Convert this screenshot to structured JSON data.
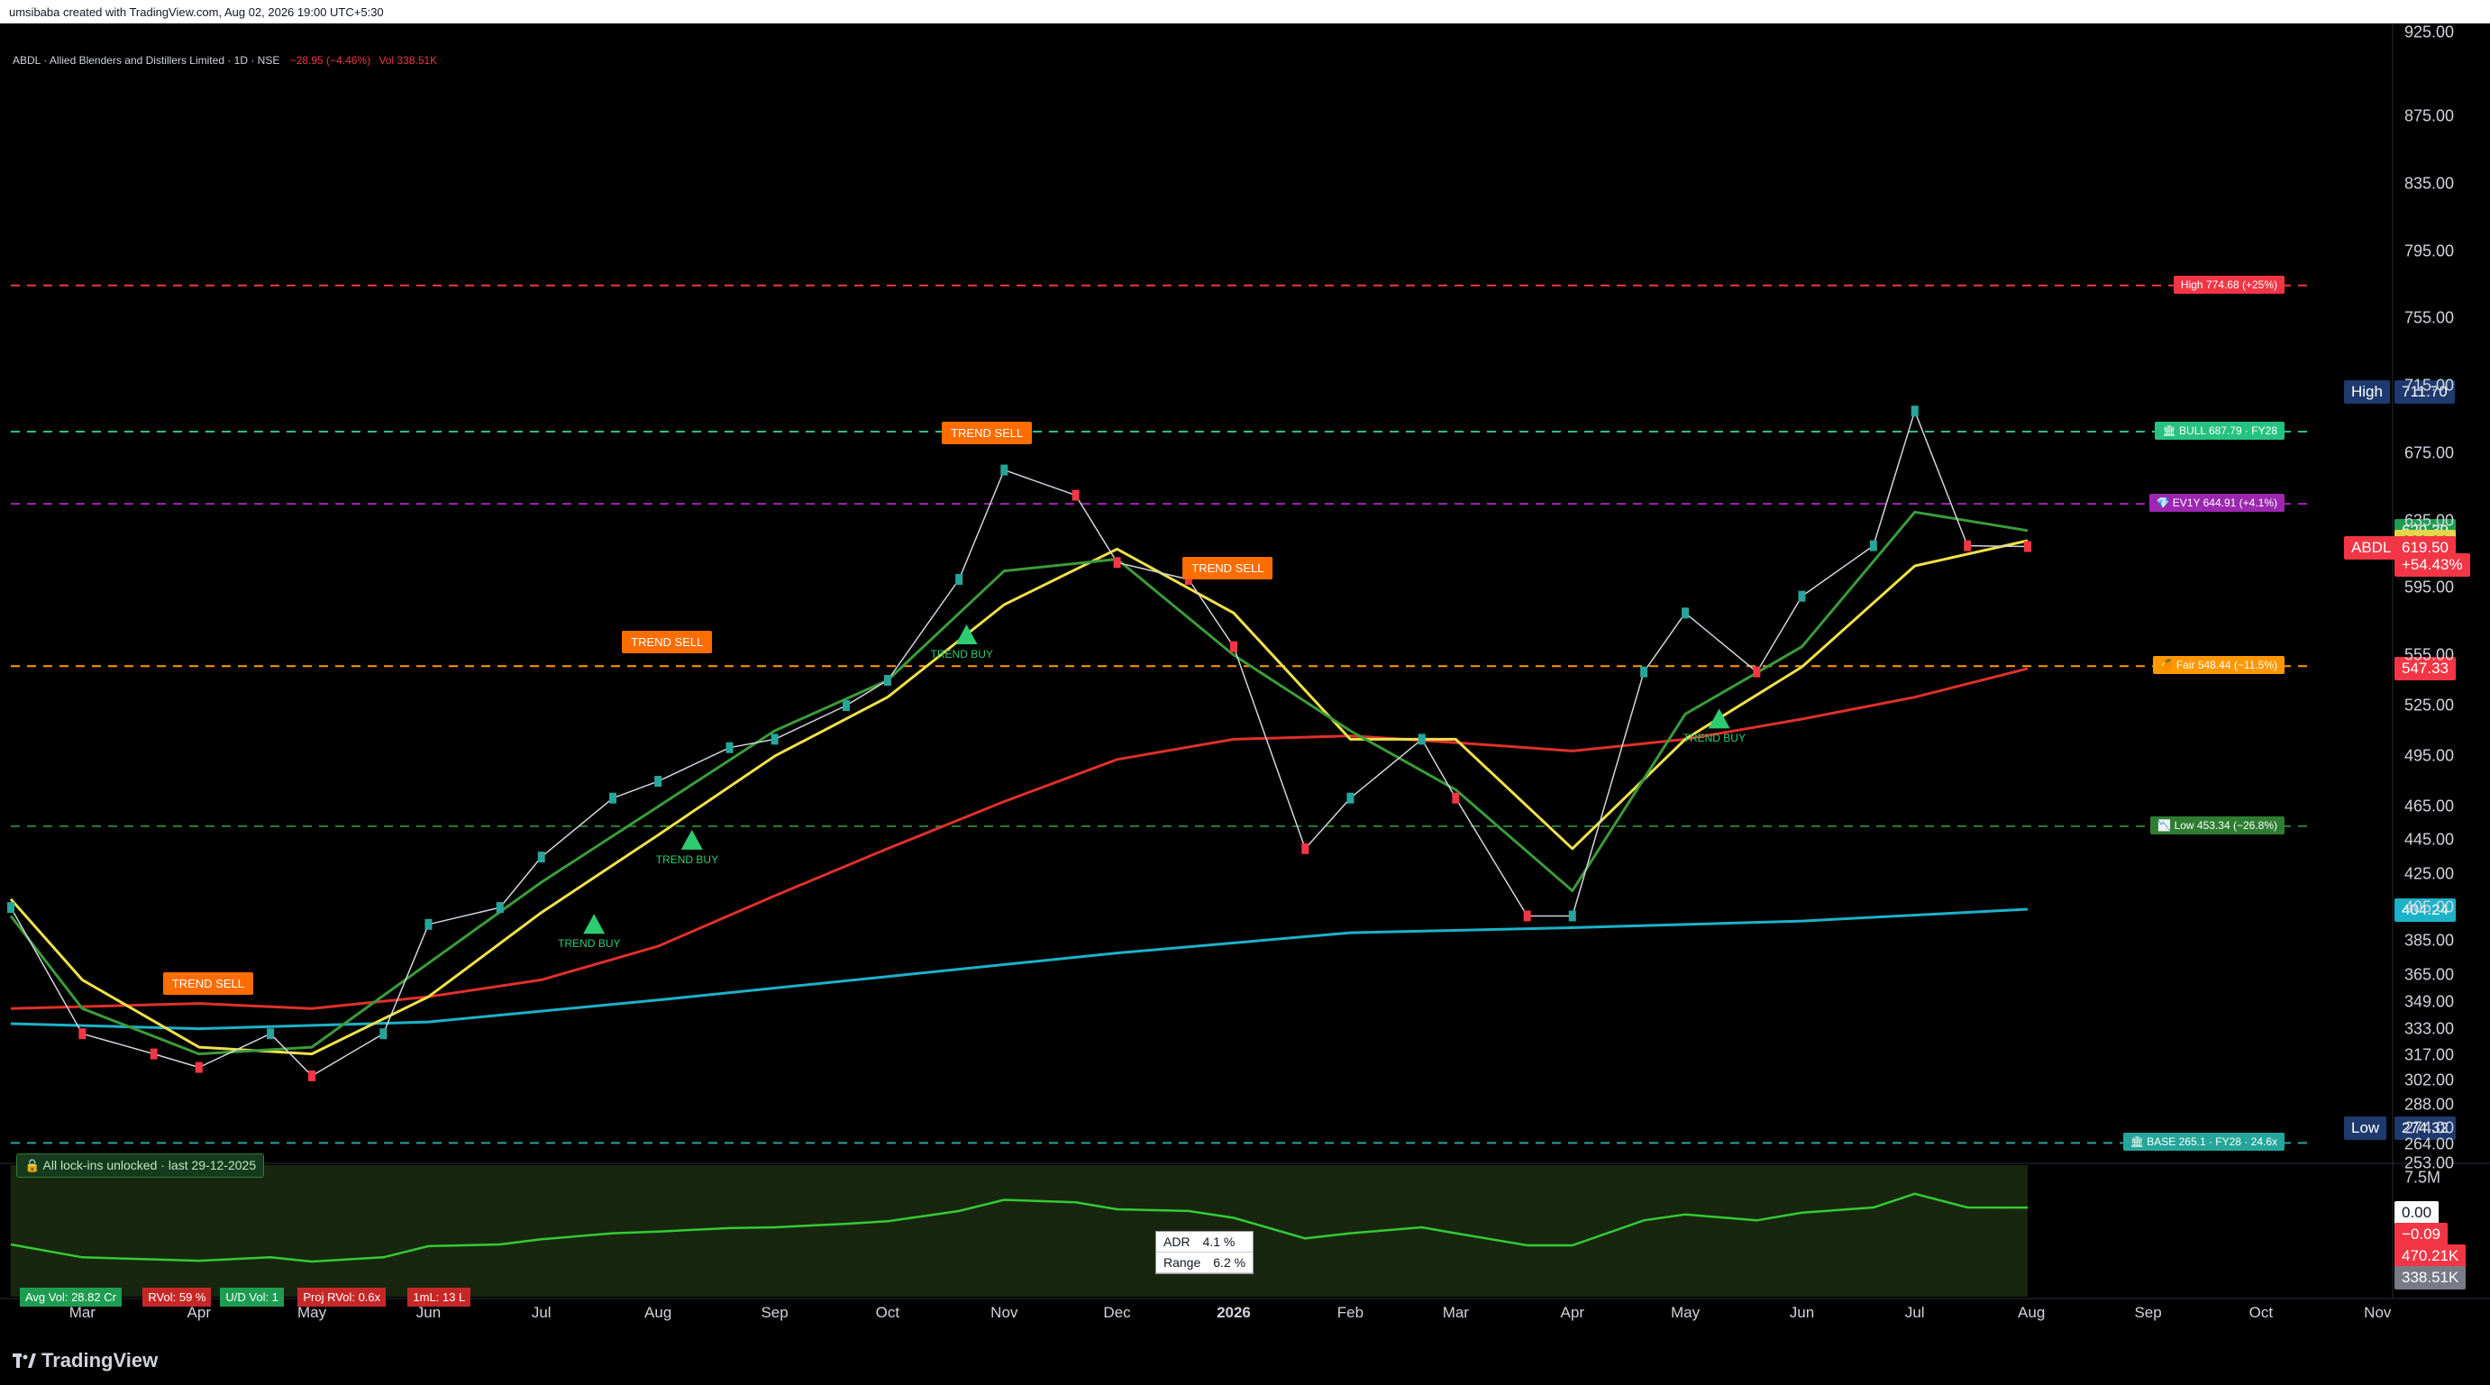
{
  "header": {
    "credit": "umsibaba created with TradingView.com, Aug 02, 2026 19:00 UTC+5:30"
  },
  "legend": {
    "symbol": "ABDL · Allied Blenders and Distillers Limited · 1D · NSE",
    "change": "−28.95 (−4.46%)",
    "vol_label": "Vol",
    "vol_value": "338.51K"
  },
  "lockin": "🔒 All lock-ins unlocked · last 29-12-2025",
  "footer": {
    "brand": "TradingView"
  },
  "colors": {
    "up": "#26a69a",
    "down": "#f23645",
    "ema_fast": "#3a9c3a",
    "ema_mid": "#f0e04a",
    "ema_slow": "#e0302a",
    "ema_long": "#1cb2c8",
    "bg": "#000000"
  },
  "chart_data": {
    "type": "line",
    "price_levels": {
      "high_target": {
        "label": "High 774.68 (+25%)",
        "value": 774.68,
        "color": "#f23645"
      },
      "bull": {
        "label": "🏛 BULL 687.79 · FY28",
        "value": 687.79,
        "color": "#26c281"
      },
      "ev1y": {
        "label": "💎 EV1Y 644.91 (+4.1%)",
        "value": 644.91,
        "color": "#9c27b0"
      },
      "fair": {
        "label": "🍊 Fair 548.44 (−11.5%)",
        "value": 548.44,
        "color": "#ff9800"
      },
      "low_target": {
        "label": "📉 Low 453.34 (−26.8%)",
        "value": 453.34,
        "color": "#2e7d32"
      },
      "base": {
        "label": "🏛 BASE 265.1 · FY28 · 24.6x",
        "value": 265.1,
        "color": "#26a69a"
      }
    },
    "right_tags": [
      {
        "label": "High",
        "value": "711.70",
        "color": "#1e3a6e",
        "y": 711.7
      },
      {
        "label": "",
        "value": "629.39",
        "color": "#1e9d52",
        "y": 629.39
      },
      {
        "label": "",
        "value": "622.98",
        "color": "#e6d44a",
        "y": 622.98
      },
      {
        "label": "ABDL",
        "value": "619.50",
        "color": "#f23645",
        "y": 619.5
      },
      {
        "label": "",
        "value": "+54.43%",
        "color": "#f23645",
        "y": 609.0
      },
      {
        "label": "",
        "value": "547.33",
        "color": "#f23645",
        "y": 547.33
      },
      {
        "label": "",
        "value": "404.24",
        "color": "#1cb2c8",
        "y": 404.24
      },
      {
        "label": "Low",
        "value": "274.32",
        "color": "#1e3a6e",
        "y": 274.32
      }
    ],
    "y_ticks": [
      "925.00",
      "875.00",
      "835.00",
      "795.00",
      "755.00",
      "715.00",
      "675.00",
      "635.00",
      "595.00",
      "555.00",
      "525.00",
      "495.00",
      "465.00",
      "445.00",
      "425.00",
      "405.00",
      "385.00",
      "365.00",
      "349.00",
      "333.00",
      "317.00",
      "302.00",
      "288.00",
      "274.00",
      "264.00",
      "253.00"
    ],
    "x_ticks": [
      {
        "label": "Mar",
        "date": "2025-03-01"
      },
      {
        "label": "Apr",
        "date": "2025-04-01"
      },
      {
        "label": "May",
        "date": "2025-05-01"
      },
      {
        "label": "Jun",
        "date": "2025-06-01"
      },
      {
        "label": "Jul",
        "date": "2025-07-01"
      },
      {
        "label": "Aug",
        "date": "2025-08-01"
      },
      {
        "label": "Sep",
        "date": "2025-09-01"
      },
      {
        "label": "Oct",
        "date": "2025-10-01"
      },
      {
        "label": "Nov",
        "date": "2025-11-01"
      },
      {
        "label": "Dec",
        "date": "2025-12-01"
      },
      {
        "label": "2026",
        "date": "2026-01-01"
      },
      {
        "label": "Feb",
        "date": "2026-02-01"
      },
      {
        "label": "Mar",
        "date": "2026-03-01"
      },
      {
        "label": "Apr",
        "date": "2026-04-01"
      },
      {
        "label": "May",
        "date": "2026-05-01"
      },
      {
        "label": "Jun",
        "date": "2026-06-01"
      },
      {
        "label": "Jul",
        "date": "2026-07-01"
      },
      {
        "label": "Aug",
        "date": "2026-08-01"
      },
      {
        "label": "Sep",
        "date": "2026-09-01"
      },
      {
        "label": "Oct",
        "date": "2026-10-01"
      },
      {
        "label": "Nov",
        "date": "2026-11-01"
      }
    ],
    "series": [
      {
        "name": "",
        "color": "#1cb2c8",
        "x": [
          "2025-02-10",
          "2025-04-01",
          "2025-06-01",
          "2025-08-01",
          "2025-10-01",
          "2025-12-01",
          "2026-02-01",
          "2026-04-01",
          "2026-06-01",
          "2026-07-31"
        ],
        "y": [
          336,
          333,
          337,
          350,
          364,
          378,
          390,
          393,
          397,
          404
        ]
      },
      {
        "name": "",
        "color": "#e0302a",
        "x": [
          "2025-02-10",
          "2025-04-01",
          "2025-05-01",
          "2025-06-01",
          "2025-07-01",
          "2025-08-01",
          "2025-09-01",
          "2025-10-01",
          "2025-11-01",
          "2025-12-01",
          "2026-01-01",
          "2026-02-01",
          "2026-03-01",
          "2026-04-01",
          "2026-05-01",
          "2026-06-01",
          "2026-07-01",
          "2026-07-31"
        ],
        "y": [
          345,
          348,
          345,
          352,
          362,
          382,
          412,
          440,
          468,
          493,
          505,
          507,
          503,
          498,
          505,
          517,
          530,
          547
        ]
      },
      {
        "name": "",
        "color": "#f0e04a",
        "x": [
          "2025-02-10",
          "2025-03-01",
          "2025-04-01",
          "2025-05-01",
          "2025-06-01",
          "2025-07-01",
          "2025-08-01",
          "2025-09-01",
          "2025-10-01",
          "2025-11-01",
          "2025-12-01",
          "2026-01-01",
          "2026-02-01",
          "2026-03-01",
          "2026-04-01",
          "2026-05-01",
          "2026-06-01",
          "2026-07-01",
          "2026-07-31"
        ],
        "y": [
          410,
          362,
          322,
          318,
          352,
          402,
          448,
          495,
          530,
          585,
          618,
          580,
          505,
          505,
          440,
          505,
          548,
          608,
          623
        ]
      },
      {
        "name": "",
        "color": "#3a9c3a",
        "x": [
          "2025-02-10",
          "2025-03-01",
          "2025-04-01",
          "2025-05-01",
          "2025-06-01",
          "2025-07-01",
          "2025-08-01",
          "2025-09-01",
          "2025-10-01",
          "2025-11-01",
          "2025-12-01",
          "2026-01-01",
          "2026-02-01",
          "2026-03-01",
          "2026-04-01",
          "2026-05-01",
          "2026-06-01",
          "2026-07-01",
          "2026-07-31"
        ],
        "y": [
          400,
          345,
          318,
          322,
          372,
          420,
          465,
          510,
          540,
          605,
          612,
          555,
          510,
          475,
          415,
          520,
          560,
          640,
          629
        ]
      },
      {
        "name": "",
        "color": "#d1d4dc",
        "x": [
          "2025-02-10",
          "2025-03-01",
          "2025-03-20",
          "2025-04-01",
          "2025-04-20",
          "2025-05-01",
          "2025-05-20",
          "2025-06-01",
          "2025-06-20",
          "2025-07-01",
          "2025-07-20",
          "2025-08-01",
          "2025-08-20",
          "2025-09-01",
          "2025-09-20",
          "2025-10-01",
          "2025-10-20",
          "2025-11-01",
          "2025-11-20",
          "2025-12-01",
          "2025-12-20",
          "2026-01-01",
          "2026-01-20",
          "2026-02-01",
          "2026-02-20",
          "2026-03-01",
          "2026-03-20",
          "2026-04-01",
          "2026-04-20",
          "2026-05-01",
          "2026-05-20",
          "2026-06-01",
          "2026-06-20",
          "2026-07-01",
          "2026-07-15",
          "2026-07-31"
        ],
        "y": [
          405,
          330,
          318,
          310,
          330,
          305,
          330,
          395,
          405,
          435,
          470,
          480,
          500,
          505,
          525,
          540,
          600,
          665,
          650,
          610,
          600,
          560,
          440,
          470,
          505,
          470,
          400,
          400,
          545,
          580,
          545,
          590,
          620,
          700,
          620,
          619.5
        ]
      }
    ],
    "signals": [
      {
        "text": "TREND SELL",
        "date": "2025-04-01",
        "price": 345
      },
      {
        "text": "TREND SELL",
        "date": "2025-08-01",
        "price": 548
      },
      {
        "text": "TREND SELL",
        "date": "2025-10-25",
        "price": 672
      },
      {
        "text": "TREND SELL",
        "date": "2025-12-28",
        "price": 592
      },
      {
        "text": "TREND BUY",
        "date": "2025-07-15",
        "price": 398
      },
      {
        "text": "TREND BUY",
        "date": "2025-08-10",
        "price": 448
      },
      {
        "text": "TREND BUY",
        "date": "2025-10-22",
        "price": 570
      },
      {
        "text": "TREND BUY",
        "date": "2026-05-10",
        "price": 520
      }
    ],
    "ylim": [
      253,
      925
    ],
    "xlim": [
      "2025-02-10",
      "2026-11-05"
    ],
    "grid": false,
    "sub_panel": {
      "y_ticks": [
        "7.5M"
      ],
      "tags": [
        {
          "value": "0.00",
          "color": "#ffffff",
          "text_color": "#131722"
        },
        {
          "value": "−0.09",
          "color": "#f23645",
          "text_color": "#ffffff"
        },
        {
          "value": "470.21K",
          "color": "#f23645",
          "text_color": "#ffffff"
        },
        {
          "value": "338.51K",
          "color": "#787b86",
          "text_color": "#ffffff"
        }
      ],
      "adr": {
        "label": "ADR",
        "value": "4.1 %"
      },
      "range": {
        "label": "Range",
        "value": "6.2 %"
      },
      "stats": [
        {
          "text": "Avg Vol: 28.82 Cr",
          "color": "#1e9d52"
        },
        {
          "text": "RVol: 59 %",
          "color": "#c62828"
        },
        {
          "text": "U/D Vol: 1",
          "color": "#1e9d52"
        },
        {
          "text": "Proj RVol: 0.6x",
          "color": "#c62828"
        },
        {
          "text": "1mL: 13 L",
          "color": "#c62828"
        }
      ]
    }
  }
}
